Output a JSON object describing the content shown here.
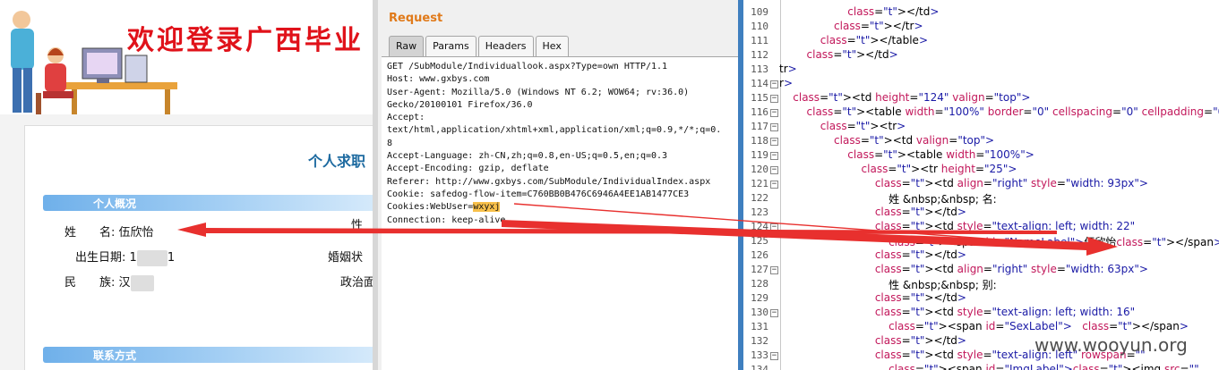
{
  "website": {
    "banner_title": "欢迎登录广西毕业",
    "page_heading": "个人求职",
    "section_personal": "个人概况",
    "section_contact": "联系方式",
    "name_label": "姓　　名:",
    "name_value": "伍欣怡",
    "gender_label": "性",
    "birth_label": "出生日期:",
    "birth_value_start": "1",
    "birth_value_end": "1",
    "marriage_label": "婚姻状",
    "ethnic_label": "民　　族:",
    "ethnic_value": "汉",
    "politics_label": "政治面"
  },
  "burp": {
    "title": "Request",
    "tabs": [
      "Raw",
      "Params",
      "Headers",
      "Hex"
    ],
    "active_tab": "Raw",
    "lines": [
      "GET /SubModule/Individuallook.aspx?Type=own HTTP/1.1",
      "Host: www.gxbys.com",
      "User-Agent: Mozilla/5.0 (Windows NT 6.2; WOW64; rv:36.0)",
      "Gecko/20100101 Firefox/36.0",
      "Accept:",
      "text/html,application/xhtml+xml,application/xml;q=0.9,*/*;q=0.",
      "8",
      "Accept-Language: zh-CN,zh;q=0.8,en-US;q=0.5,en;q=0.3",
      "Accept-Encoding: gzip, deflate",
      "Referer: http://www.gxbys.com/SubModule/IndividualIndex.aspx",
      "Cookie: safedog-flow-item=C760BB0B476C6946A4EE1AB1477CE3",
      "Cookies:WebUser=",
      "Connection: keep-alive"
    ],
    "highlighted_value": "wxyxj"
  },
  "source": {
    "lines": [
      {
        "n": "109",
        "fold": false,
        "code": "                    </td>"
      },
      {
        "n": "110",
        "fold": false,
        "code": "                </tr>"
      },
      {
        "n": "111",
        "fold": false,
        "code": "            </table>"
      },
      {
        "n": "112",
        "fold": false,
        "code": "        </td>"
      },
      {
        "n": "113",
        "fold": false,
        "code": "tr>"
      },
      {
        "n": "114",
        "fold": true,
        "code": "r>"
      },
      {
        "n": "115",
        "fold": true,
        "code": "    <td height=\"124\" valign=\"top\">"
      },
      {
        "n": "116",
        "fold": true,
        "code": "        <table width=\"100%\" border=\"0\" cellspacing=\"0\" cellpadding=\"0\">"
      },
      {
        "n": "117",
        "fold": true,
        "code": "            <tr>"
      },
      {
        "n": "118",
        "fold": true,
        "code": "                <td valign=\"top\">"
      },
      {
        "n": "119",
        "fold": true,
        "code": "                    <table width=\"100%\">"
      },
      {
        "n": "120",
        "fold": true,
        "code": "                        <tr height=\"25\">"
      },
      {
        "n": "121",
        "fold": true,
        "code": "                            <td align=\"right\" style=\"width: 93px\">"
      },
      {
        "n": "122",
        "fold": false,
        "code": "                                姓 &nbsp;&nbsp; 名:"
      },
      {
        "n": "123",
        "fold": false,
        "code": "                            </td>"
      },
      {
        "n": "124",
        "fold": true,
        "code": "                            <td style=\"text-align: left; width: 22"
      },
      {
        "n": "125",
        "fold": false,
        "code": "                                <span id=\"NameLabel\">伍欣怡</span>"
      },
      {
        "n": "126",
        "fold": false,
        "code": "                            </td>"
      },
      {
        "n": "127",
        "fold": true,
        "code": "                            <td align=\"right\" style=\"width: 63px\">"
      },
      {
        "n": "128",
        "fold": false,
        "code": "                                性 &nbsp;&nbsp; 别:"
      },
      {
        "n": "129",
        "fold": false,
        "code": "                            </td>"
      },
      {
        "n": "130",
        "fold": true,
        "code": "                            <td style=\"text-align: left; width: 16"
      },
      {
        "n": "131",
        "fold": false,
        "code": "                                <span id=\"SexLabel\">   </span>"
      },
      {
        "n": "132",
        "fold": false,
        "code": "                            </td>"
      },
      {
        "n": "133",
        "fold": true,
        "code": "                            <td style=\"text-align: left\" rowspan=\""
      },
      {
        "n": "134",
        "fold": false,
        "code": "                                <span id=\"ImgLabel\"><img src=\""
      }
    ]
  },
  "watermark": "www.wooyun.org",
  "colors": {
    "arrow": "#e8302e",
    "highlight": "#f8c04a",
    "burp_title": "#e07a1a",
    "banner_title": "#e0121a"
  }
}
